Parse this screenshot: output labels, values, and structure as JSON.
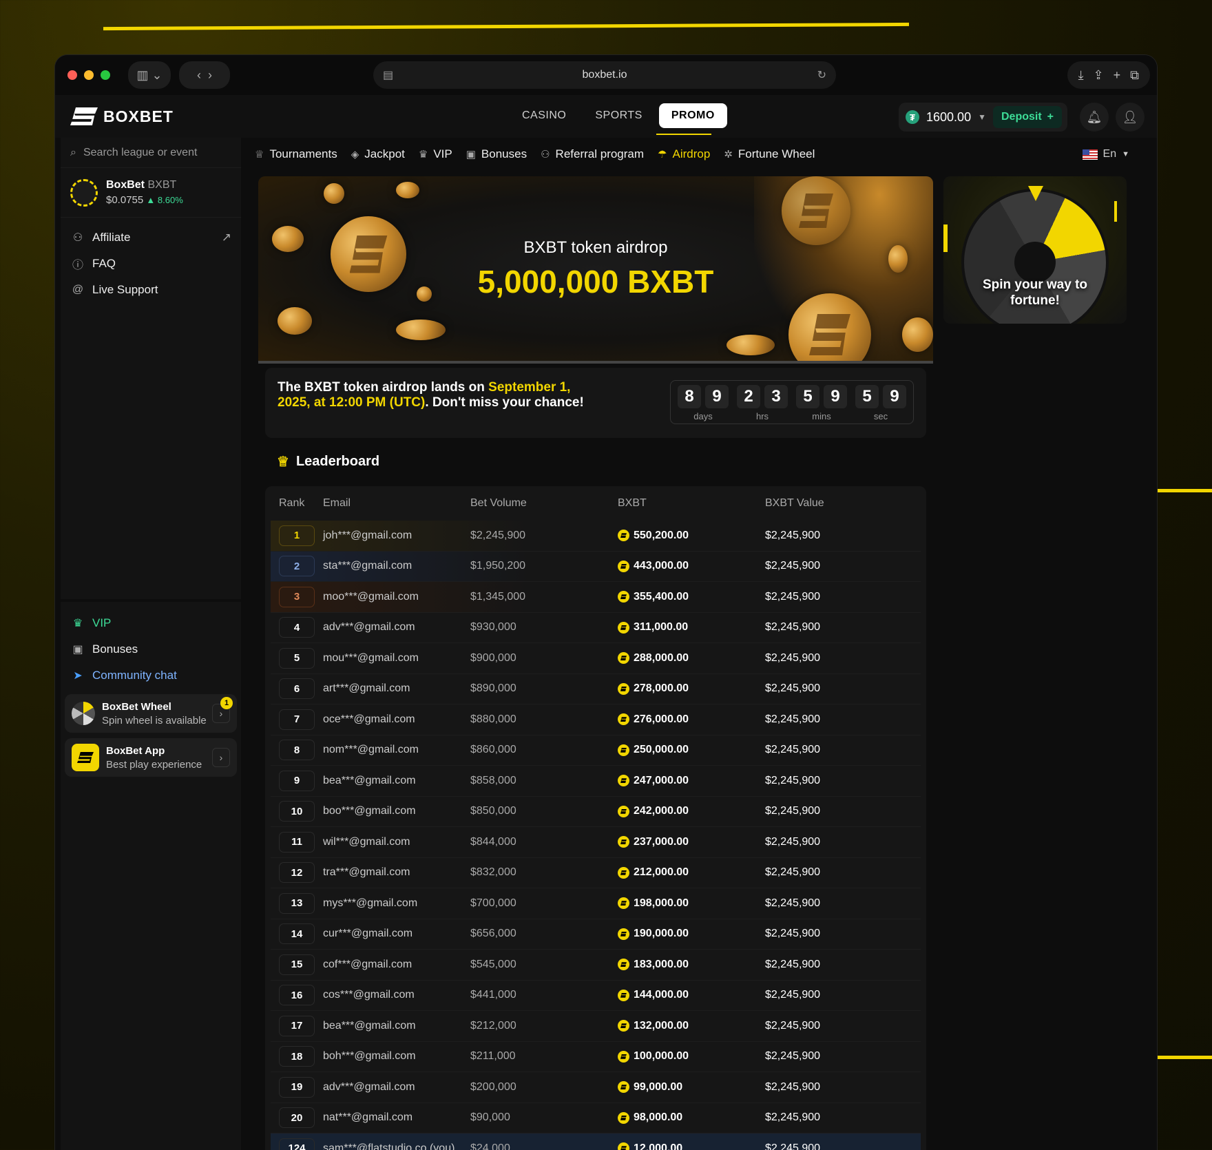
{
  "browser": {
    "url": "boxbet.io"
  },
  "app": {
    "logo": "BOXBET",
    "main_tabs": [
      "CASINO",
      "SPORTS",
      "PROMO"
    ],
    "balance": "1600.00",
    "deposit_label": "Deposit",
    "colors": {
      "accent": "#f2d600",
      "bg": "#0d0d0d",
      "panel": "#161616",
      "green": "#3ddc97"
    }
  },
  "sidebar": {
    "search_placeholder": "Search league or event",
    "token": {
      "name": "BoxBet",
      "ticker": "BXBT",
      "price": "$0.0755",
      "change": "8.60%"
    },
    "links": [
      {
        "label": "Affiliate",
        "icon": "user-icon"
      },
      {
        "label": "FAQ",
        "icon": "help-icon"
      },
      {
        "label": "Live Support",
        "icon": "at-icon"
      }
    ],
    "lower": [
      {
        "label": "VIP",
        "icon": "crown-icon"
      },
      {
        "label": "Bonuses",
        "icon": "gift-icon"
      },
      {
        "label": "Community chat",
        "icon": "telegram-icon"
      }
    ],
    "wheel_card": {
      "title": "BoxBet Wheel",
      "subtitle": "Spin wheel is available",
      "badge": "1"
    },
    "app_card": {
      "title": "BoxBet App",
      "subtitle": "Best play experience"
    }
  },
  "promo_nav": [
    "Tournaments",
    "Jackpot",
    "VIP",
    "Bonuses",
    "Referral program",
    "Airdrop",
    "Fortune Wheel"
  ],
  "language": "En",
  "hero": {
    "subtitle": "BXBT token airdrop",
    "amount": "5,000,000 BXBT"
  },
  "wheel_promo": {
    "text": "Spin your way to fortune!"
  },
  "countdown": {
    "text_a": "The BXBT token airdrop lands on ",
    "text_highlight": "September 1, 2025, at 12:00 PM (UTC)",
    "text_b": ". Don't miss your chance!",
    "days": [
      "8",
      "9"
    ],
    "hrs": [
      "2",
      "3"
    ],
    "mins": [
      "5",
      "9"
    ],
    "sec": [
      "5",
      "9"
    ],
    "labels": {
      "days": "days",
      "hrs": "hrs",
      "mins": "mins",
      "sec": "sec"
    }
  },
  "leaderboard": {
    "title": "Leaderboard",
    "columns": [
      "Rank",
      "Email",
      "Bet Volume",
      "BXBT",
      "BXBT Value"
    ],
    "rows": [
      [
        "1",
        "joh***@gmail.com",
        "$2,245,900",
        "550,200.00",
        "$2,245,900"
      ],
      [
        "2",
        "sta***@gmail.com",
        "$1,950,200",
        "443,000.00",
        "$2,245,900"
      ],
      [
        "3",
        "moo***@gmail.com",
        "$1,345,000",
        "355,400.00",
        "$2,245,900"
      ],
      [
        "4",
        "adv***@gmail.com",
        "$930,000",
        "311,000.00",
        "$2,245,900"
      ],
      [
        "5",
        "mou***@gmail.com",
        "$900,000",
        "288,000.00",
        "$2,245,900"
      ],
      [
        "6",
        "art***@gmail.com",
        "$890,000",
        "278,000.00",
        "$2,245,900"
      ],
      [
        "7",
        "oce***@gmail.com",
        "$880,000",
        "276,000.00",
        "$2,245,900"
      ],
      [
        "8",
        "nom***@gmail.com",
        "$860,000",
        "250,000.00",
        "$2,245,900"
      ],
      [
        "9",
        "bea***@gmail.com",
        "$858,000",
        "247,000.00",
        "$2,245,900"
      ],
      [
        "10",
        "boo***@gmail.com",
        "$850,000",
        "242,000.00",
        "$2,245,900"
      ],
      [
        "11",
        "wil***@gmail.com",
        "$844,000",
        "237,000.00",
        "$2,245,900"
      ],
      [
        "12",
        "tra***@gmail.com",
        "$832,000",
        "212,000.00",
        "$2,245,900"
      ],
      [
        "13",
        "mys***@gmail.com",
        "$700,000",
        "198,000.00",
        "$2,245,900"
      ],
      [
        "14",
        "cur***@gmail.com",
        "$656,000",
        "190,000.00",
        "$2,245,900"
      ],
      [
        "15",
        "cof***@gmail.com",
        "$545,000",
        "183,000.00",
        "$2,245,900"
      ],
      [
        "16",
        "cos***@gmail.com",
        "$441,000",
        "144,000.00",
        "$2,245,900"
      ],
      [
        "17",
        "bea***@gmail.com",
        "$212,000",
        "132,000.00",
        "$2,245,900"
      ],
      [
        "18",
        "boh***@gmail.com",
        "$211,000",
        "100,000.00",
        "$2,245,900"
      ],
      [
        "19",
        "adv***@gmail.com",
        "$200,000",
        "99,000.00",
        "$2,245,900"
      ],
      [
        "20",
        "nat***@gmail.com",
        "$90,000",
        "98,000.00",
        "$2,245,900"
      ],
      [
        "124",
        "sam***@flatstudio.co (you)",
        "$24,000",
        "12,000.00",
        "$2,245,900"
      ]
    ]
  }
}
